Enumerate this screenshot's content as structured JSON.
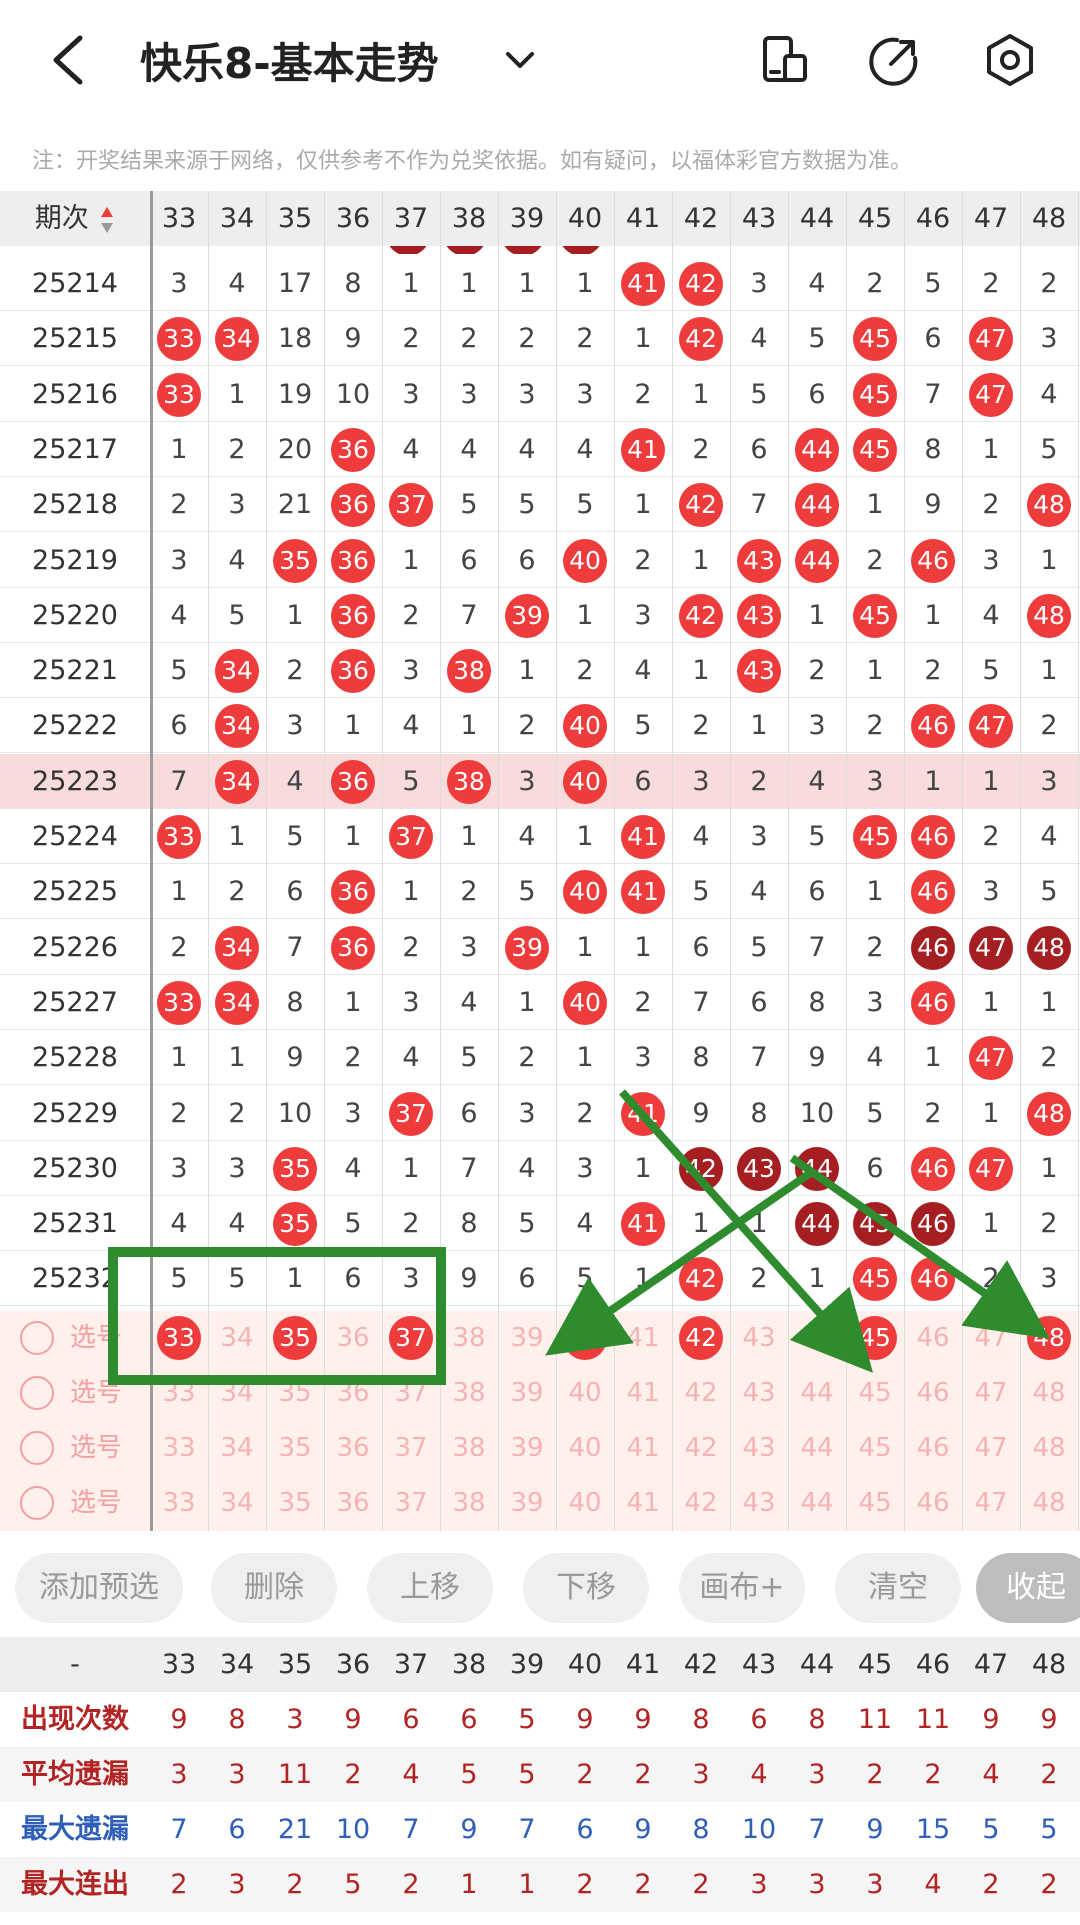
{
  "header": {
    "title": "快乐8-基本走势",
    "note": "注：开奖结果来源于网络，仅供参考不作为兑奖依据。如有疑问，以福体彩官方数据为准。"
  },
  "grid": {
    "period_label": "期次",
    "columns": [
      "33",
      "34",
      "35",
      "36",
      "37",
      "38",
      "39",
      "40",
      "41",
      "42",
      "43",
      "44",
      "45",
      "46",
      "47",
      "48"
    ],
    "rows": [
      {
        "period": "25214",
        "cells": [
          "3",
          "4",
          "17",
          "8",
          "1",
          "1",
          "1",
          "1",
          "41",
          "42",
          "3",
          "4",
          "2",
          "5",
          "2",
          "2"
        ]
      },
      {
        "period": "25215",
        "cells": [
          "33",
          "34",
          "18",
          "9",
          "2",
          "2",
          "2",
          "2",
          "1",
          "42",
          "4",
          "5",
          "45",
          "6",
          "47",
          "3"
        ]
      },
      {
        "period": "25216",
        "cells": [
          "33",
          "1",
          "19",
          "10",
          "3",
          "3",
          "3",
          "3",
          "2",
          "1",
          "5",
          "6",
          "45",
          "7",
          "47",
          "4"
        ]
      },
      {
        "period": "25217",
        "cells": [
          "1",
          "2",
          "20",
          "36",
          "4",
          "4",
          "4",
          "4",
          "41",
          "2",
          "6",
          "44",
          "45",
          "8",
          "1",
          "5"
        ]
      },
      {
        "period": "25218",
        "cells": [
          "2",
          "3",
          "21",
          "36",
          "37",
          "5",
          "5",
          "5",
          "1",
          "42",
          "7",
          "44",
          "1",
          "9",
          "2",
          "48"
        ]
      },
      {
        "period": "25219",
        "cells": [
          "3",
          "4",
          "35",
          "36",
          "1",
          "6",
          "6",
          "40",
          "2",
          "1",
          "43",
          "44",
          "2",
          "46",
          "3",
          "1"
        ]
      },
      {
        "period": "25220",
        "cells": [
          "4",
          "5",
          "1",
          "36",
          "2",
          "7",
          "39",
          "1",
          "3",
          "42",
          "43",
          "1",
          "45",
          "1",
          "4",
          "48"
        ]
      },
      {
        "period": "25221",
        "cells": [
          "5",
          "34",
          "2",
          "36",
          "3",
          "38",
          "1",
          "2",
          "4",
          "1",
          "43",
          "2",
          "1",
          "2",
          "5",
          "1"
        ]
      },
      {
        "period": "25222",
        "cells": [
          "6",
          "34",
          "3",
          "1",
          "4",
          "1",
          "2",
          "40",
          "5",
          "2",
          "1",
          "3",
          "2",
          "46",
          "47",
          "2"
        ]
      },
      {
        "period": "25223",
        "cells": [
          "7",
          "34",
          "4",
          "36",
          "5",
          "38",
          "3",
          "40",
          "6",
          "3",
          "2",
          "4",
          "3",
          "1",
          "1",
          "3"
        ]
      },
      {
        "period": "25224",
        "cells": [
          "33",
          "1",
          "5",
          "1",
          "37",
          "1",
          "4",
          "1",
          "41",
          "4",
          "3",
          "5",
          "45",
          "46",
          "2",
          "4"
        ]
      },
      {
        "period": "25225",
        "cells": [
          "1",
          "2",
          "6",
          "36",
          "1",
          "2",
          "5",
          "40",
          "41",
          "5",
          "4",
          "6",
          "1",
          "46",
          "3",
          "5"
        ]
      },
      {
        "period": "25226",
        "cells": [
          "2",
          "34",
          "7",
          "36",
          "2",
          "3",
          "39",
          "1",
          "1",
          "6",
          "5",
          "7",
          "2",
          "46",
          "47",
          "48"
        ]
      },
      {
        "period": "25227",
        "cells": [
          "33",
          "34",
          "8",
          "1",
          "3",
          "4",
          "1",
          "40",
          "2",
          "7",
          "6",
          "8",
          "3",
          "46",
          "1",
          "1"
        ]
      },
      {
        "period": "25228",
        "cells": [
          "1",
          "1",
          "9",
          "2",
          "4",
          "5",
          "2",
          "1",
          "3",
          "8",
          "7",
          "9",
          "4",
          "1",
          "47",
          "2"
        ]
      },
      {
        "period": "25229",
        "cells": [
          "2",
          "2",
          "10",
          "3",
          "37",
          "6",
          "3",
          "2",
          "41",
          "9",
          "8",
          "10",
          "5",
          "2",
          "1",
          "48"
        ]
      },
      {
        "period": "25230",
        "cells": [
          "3",
          "3",
          "35",
          "4",
          "1",
          "7",
          "4",
          "3",
          "1",
          "42",
          "43",
          "44",
          "6",
          "46",
          "47",
          "1"
        ]
      },
      {
        "period": "25231",
        "cells": [
          "4",
          "4",
          "35",
          "5",
          "2",
          "8",
          "5",
          "4",
          "41",
          "1",
          "1",
          "44",
          "45",
          "46",
          "1",
          "2"
        ]
      },
      {
        "period": "25232",
        "cells": [
          "5",
          "5",
          "1",
          "6",
          "3",
          "9",
          "6",
          "5",
          "1",
          "42",
          "2",
          "1",
          "45",
          "46",
          "2",
          "3"
        ]
      }
    ]
  },
  "picker": {
    "label": "选号",
    "rows": [
      {
        "selected": [
          "33",
          "35",
          "37",
          "40",
          "42",
          "45",
          "48"
        ]
      },
      {
        "selected": []
      },
      {
        "selected": []
      },
      {
        "selected": []
      }
    ]
  },
  "toolbar": {
    "add": "添加预选",
    "delete": "删除",
    "up": "上移",
    "down": "下移",
    "canvas": "画布+",
    "clear": "清空",
    "collapse": "收起"
  },
  "stats": {
    "head_label": "-",
    "rows": [
      {
        "label": "出现次数",
        "color": "red",
        "values": [
          "9",
          "8",
          "3",
          "9",
          "6",
          "6",
          "5",
          "9",
          "9",
          "8",
          "6",
          "8",
          "11",
          "11",
          "9",
          "9"
        ]
      },
      {
        "label": "平均遗漏",
        "color": "red",
        "values": [
          "3",
          "3",
          "11",
          "2",
          "4",
          "5",
          "5",
          "2",
          "2",
          "3",
          "4",
          "3",
          "2",
          "2",
          "4",
          "2"
        ]
      },
      {
        "label": "最大遗漏",
        "color": "blue",
        "values": [
          "7",
          "6",
          "21",
          "10",
          "7",
          "9",
          "7",
          "6",
          "9",
          "8",
          "10",
          "7",
          "9",
          "15",
          "5",
          "5"
        ]
      },
      {
        "label": "最大连出",
        "color": "red",
        "values": [
          "2",
          "3",
          "2",
          "5",
          "2",
          "1",
          "1",
          "2",
          "2",
          "2",
          "3",
          "3",
          "3",
          "4",
          "2",
          "2"
        ]
      }
    ]
  },
  "colors": {
    "ball": "#ee3b3b",
    "ball_dark": "#a51e22",
    "highlight_row": "#f8dcdc",
    "annotation": "#2e8b2e"
  }
}
